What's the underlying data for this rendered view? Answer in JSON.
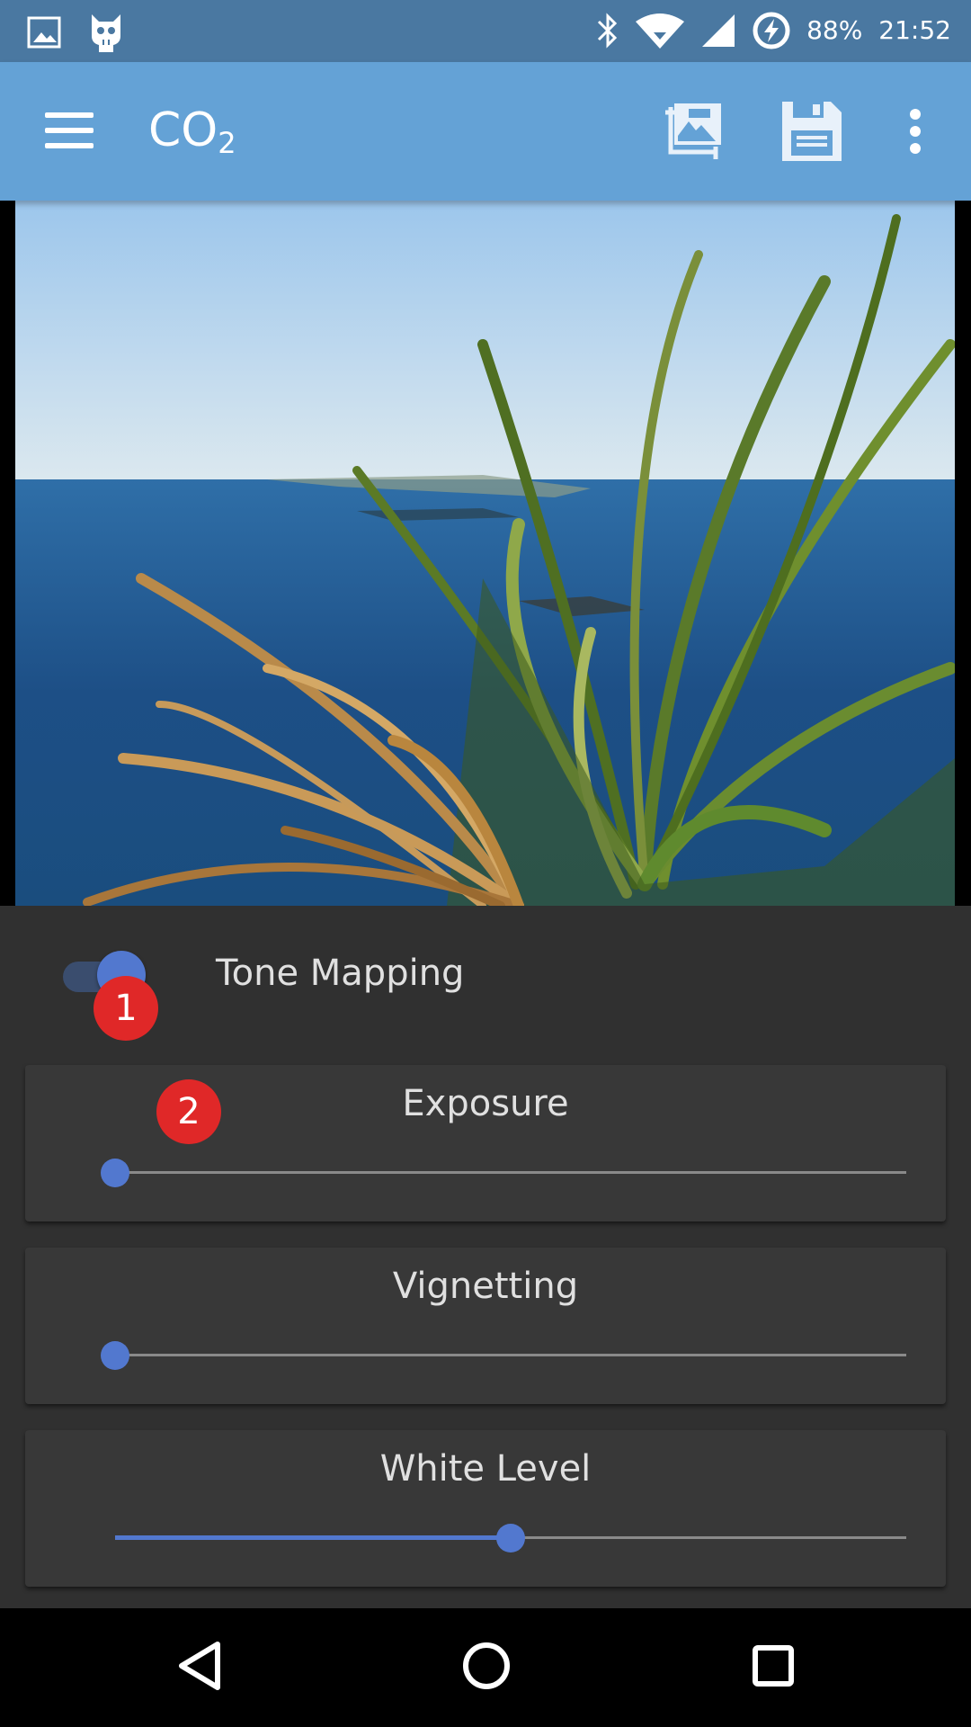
{
  "status_bar": {
    "battery": "88%",
    "time": "21:52",
    "icons": [
      "gallery-icon",
      "cyanogen-icon",
      "bluetooth-icon",
      "wifi-icon",
      "signal-icon",
      "battery-charging-icon"
    ]
  },
  "app_bar": {
    "title": "CO",
    "title_sub": "2",
    "icons": [
      "menu-icon",
      "crop-photo-icon",
      "save-icon",
      "overflow-menu-icon"
    ]
  },
  "colors": {
    "app_bar": "#64a2d6",
    "status_bar": "#4a78a1",
    "accent": "#5278cf",
    "panel": "#303030",
    "badge": "#e02828"
  },
  "panel": {
    "tone_mapping": {
      "label": "Tone Mapping",
      "enabled": true,
      "badge": "1"
    },
    "sliders": [
      {
        "label": "Exposure",
        "value_fraction": 0.0,
        "badge": "2"
      },
      {
        "label": "Vignetting",
        "value_fraction": 0.0
      },
      {
        "label": "White Level",
        "value_fraction": 0.5
      }
    ]
  },
  "nav_bar": {
    "icons": [
      "back-icon",
      "home-icon",
      "recents-icon"
    ]
  }
}
